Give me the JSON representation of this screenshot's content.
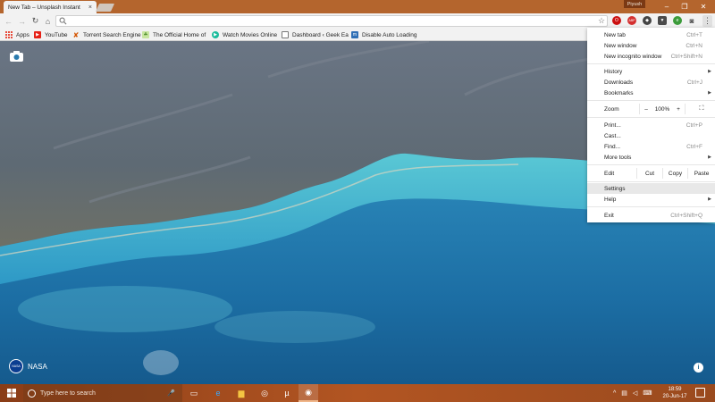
{
  "browser": {
    "tab_title": "New Tab – Unsplash Instant",
    "tab_close": "×",
    "profile_name": "Piyush",
    "window_controls": {
      "minimize": "–",
      "maximize": "❐",
      "close": "✕"
    },
    "omnibox_value": "",
    "accent": "#b4652d"
  },
  "toolbar": {
    "back": "←",
    "forward": "→",
    "reload": "↻",
    "home": "⌂",
    "star": "☆",
    "menu": "⋮",
    "extensions": [
      {
        "name": "opera-icon",
        "glyph": "O"
      },
      {
        "name": "abp-icon",
        "glyph": "ABP"
      },
      {
        "name": "shield-icon",
        "glyph": "◆"
      },
      {
        "name": "shield2-icon",
        "glyph": "▼"
      },
      {
        "name": "evernote-icon",
        "glyph": "e"
      },
      {
        "name": "camera-ext-icon",
        "glyph": "◙"
      }
    ]
  },
  "bookmarks": {
    "apps": "Apps",
    "youtube": "YouTube",
    "torrent": "Torrent Search Engine",
    "official": "The Official Home of",
    "movies": "Watch Movies Online",
    "geek": "Dashboard ‹ Geek Ea",
    "autoload": "Disable Auto Loading"
  },
  "photo": {
    "credit": "NASA",
    "info": "i"
  },
  "menu": {
    "new_tab": {
      "label": "New tab",
      "shortcut": "Ctrl+T"
    },
    "new_window": {
      "label": "New window",
      "shortcut": "Ctrl+N"
    },
    "incognito": {
      "label": "New incognito window",
      "shortcut": "Ctrl+Shift+N"
    },
    "history": {
      "label": "History"
    },
    "downloads": {
      "label": "Downloads",
      "shortcut": "Ctrl+J"
    },
    "bookmarks": {
      "label": "Bookmarks"
    },
    "zoom": {
      "label": "Zoom",
      "minus": "–",
      "value": "100%",
      "plus": "+"
    },
    "print": {
      "label": "Print...",
      "shortcut": "Ctrl+P"
    },
    "cast": {
      "label": "Cast..."
    },
    "find": {
      "label": "Find...",
      "shortcut": "Ctrl+F"
    },
    "more_tools": {
      "label": "More tools"
    },
    "edit": {
      "label": "Edit",
      "cut": "Cut",
      "copy": "Copy",
      "paste": "Paste"
    },
    "settings": {
      "label": "Settings"
    },
    "help": {
      "label": "Help"
    },
    "exit": {
      "label": "Exit",
      "shortcut": "Ctrl+Shift+Q"
    },
    "arrow": "▶"
  },
  "taskbar": {
    "search_placeholder": "Type here to search",
    "mic": "🎤",
    "apps": {
      "taskview": "▭",
      "edge": "e",
      "explorer": "▆",
      "app4": "◎",
      "utorrent": "µ",
      "chrome": "◉"
    },
    "tray": {
      "chevron": "^",
      "network": "▤",
      "volume": "◁",
      "keyboard": "⌨"
    },
    "time": "18:59",
    "date": "20-Jun-17"
  }
}
